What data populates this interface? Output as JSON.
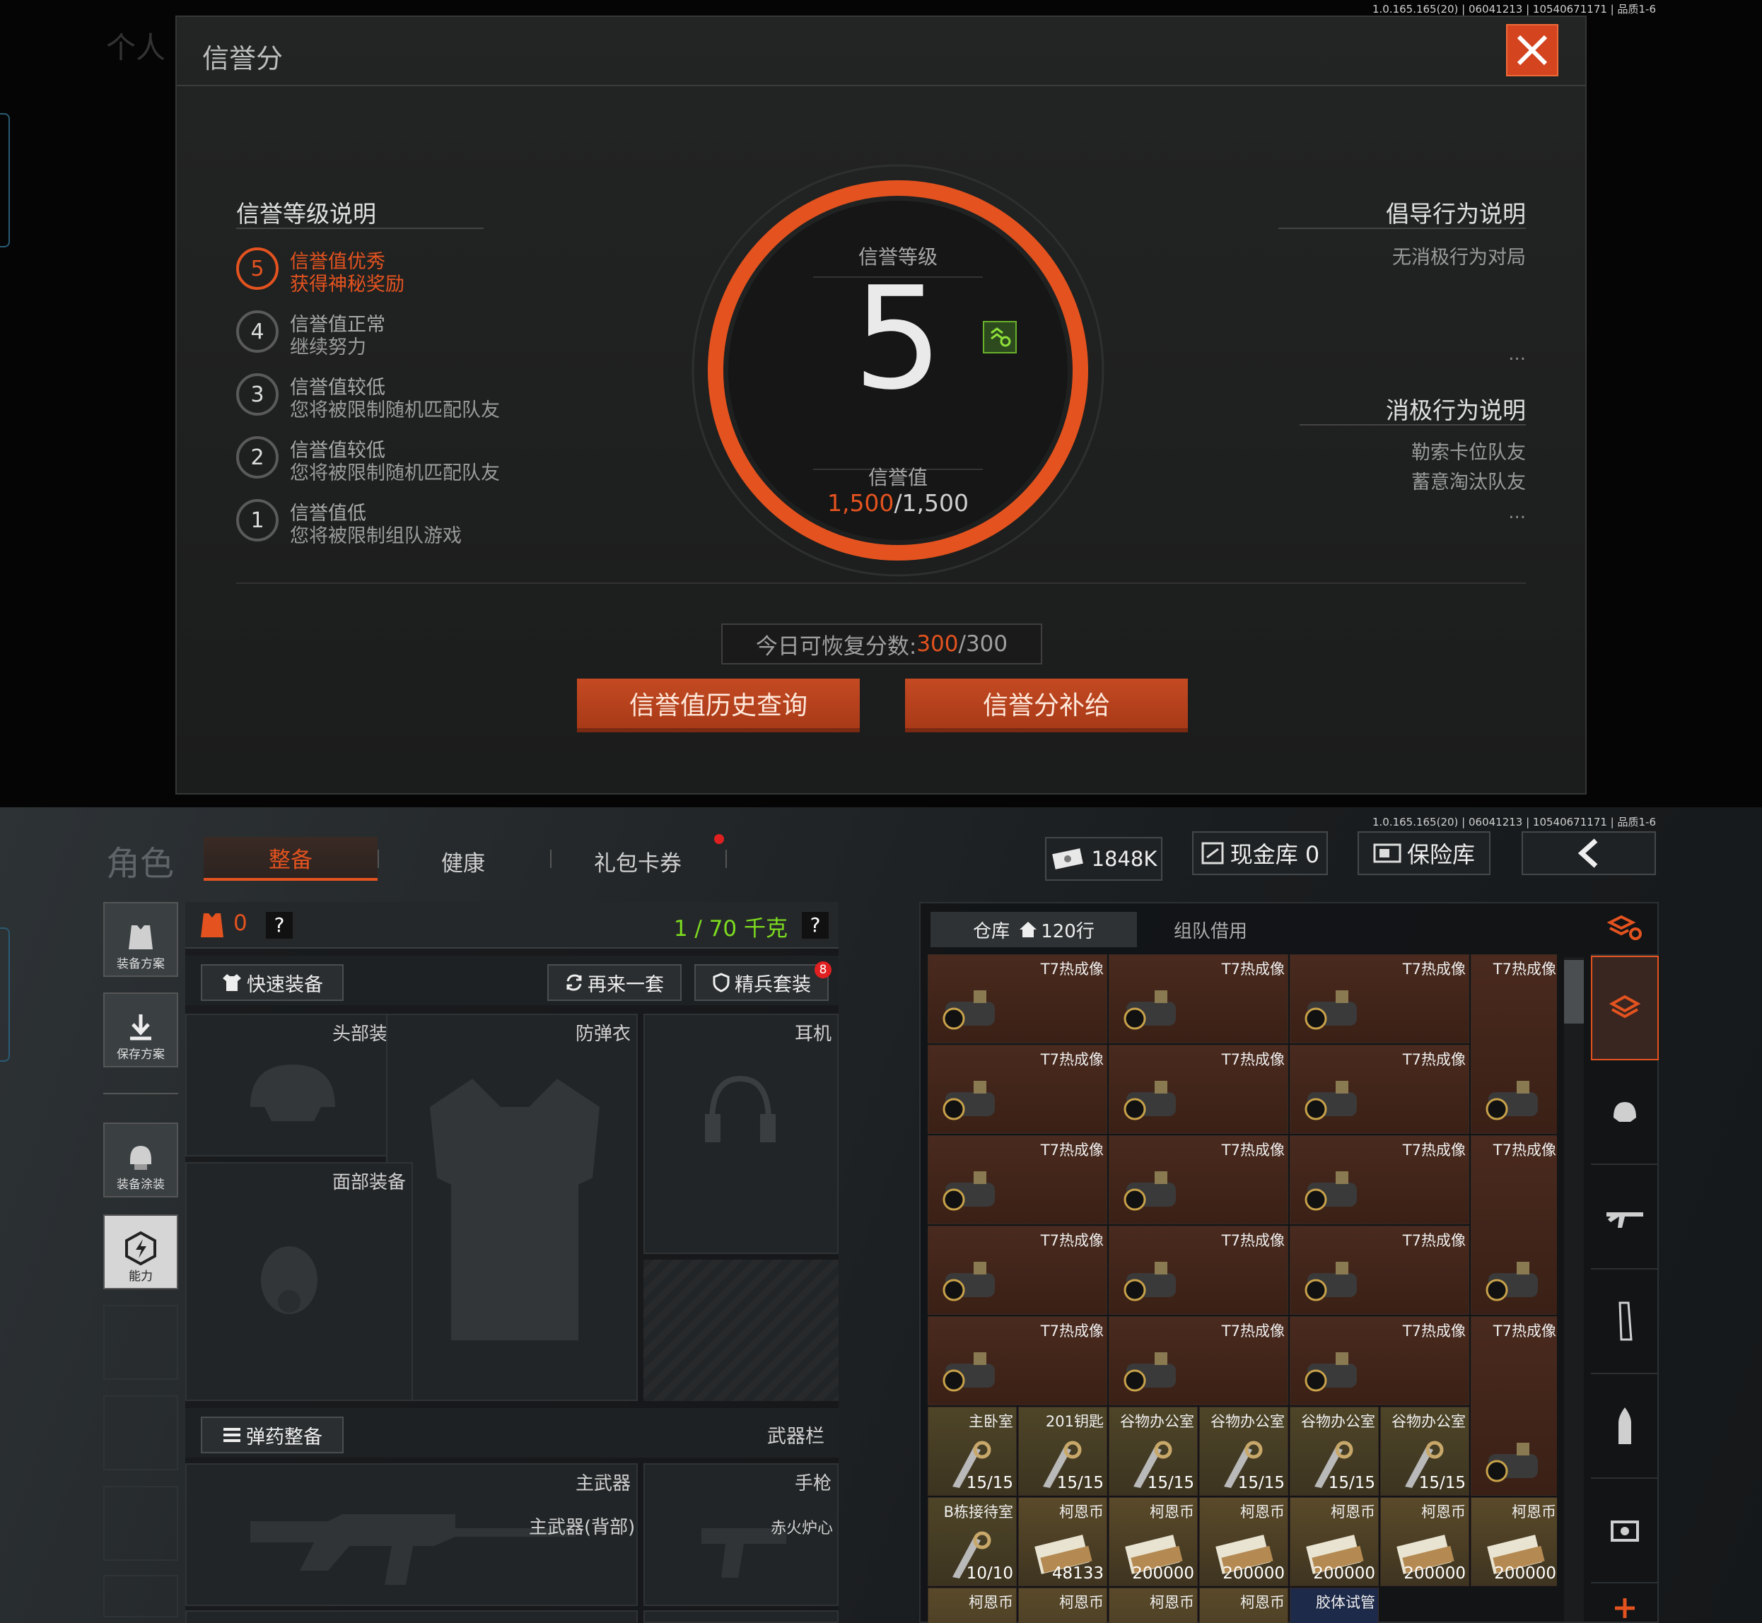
{
  "version_top": "1.0.165.165(20) | 06041213 | 10540671171 | 品质1-6",
  "version_bottom": "1.0.165.165(20) | 06041213 | 10540671171 | 品质1-6",
  "modal": {
    "title": "信誉分",
    "background_text": "个人",
    "left_section_title": "信誉等级说明",
    "levels": [
      {
        "num": "5",
        "line1": "信誉值优秀",
        "line2": "获得神秘奖励",
        "active": true
      },
      {
        "num": "4",
        "line1": "信誉值正常",
        "line2": "继续努力",
        "active": false
      },
      {
        "num": "3",
        "line1": "信誉值较低",
        "line2": "您将被限制随机匹配队友",
        "active": false
      },
      {
        "num": "2",
        "line1": "信誉值较低",
        "line2": "您将被限制随机匹配队友",
        "active": false
      },
      {
        "num": "1",
        "line1": "信誉值低",
        "line2": "您将被限制组队游戏",
        "active": false
      }
    ],
    "gauge": {
      "level_label": "信誉等级",
      "level_value": "5",
      "value_label": "信誉值",
      "current": "1,500",
      "max": "/1,500"
    },
    "positive_title": "倡导行为说明",
    "positive_items": [
      "无消极行为对局"
    ],
    "negative_title": "消极行为说明",
    "negative_items": [
      "勒索卡位队友",
      "蓄意淘汰队友"
    ],
    "ellipsis": "...",
    "recover_label": "今日可恢复分数:",
    "recover_current": "300",
    "recover_max": "/300",
    "btn_history": "信誉值历史查询",
    "btn_supply": "信誉分补给"
  },
  "colors": {
    "accent": "#e4531f",
    "green": "#7ddc1f",
    "active_level": "#e4531f"
  },
  "header": {
    "title": "角色",
    "tabs": [
      "整备",
      "健康",
      "礼包卡券"
    ],
    "money": "1848K",
    "cash_vault": "现金库 0",
    "safe": "保险库"
  },
  "left_bar": [
    "装备方案",
    "保存方案",
    "装备涂装",
    "能力"
  ],
  "gear": {
    "armor_count": "0",
    "weight": "1 / 70 千克",
    "quick_equip": "快速装备",
    "again": "再来一套",
    "elite": "精兵套装",
    "elite_badge": "8",
    "slots": {
      "head": "头部装备",
      "armor": "防弹衣",
      "headset": "耳机",
      "face": "面部装备"
    },
    "ammo_equip": "弹药整备",
    "weapon_bar": "武器栏",
    "weapons": {
      "primary": "主武器",
      "pistol": "手枪",
      "primary_back": "主武器(背部)",
      "melee": "赤火炉心"
    }
  },
  "warehouse": {
    "tab_storage": "仓库",
    "rows": "120行",
    "tab_team": "组队借用",
    "thermal_name": "T7热成像",
    "keys": [
      {
        "name": "主卧室",
        "count": "15/15"
      },
      {
        "name": "201钥匙",
        "count": "15/15"
      },
      {
        "name": "谷物办公室",
        "count": "15/15"
      },
      {
        "name": "谷物办公室",
        "count": "15/15"
      },
      {
        "name": "谷物办公室",
        "count": "15/15"
      },
      {
        "name": "谷物办公室",
        "count": "15/15"
      }
    ],
    "row7": [
      {
        "name": "B栋接待室",
        "count": "10/10"
      },
      {
        "name": "柯恩币",
        "count": "48133"
      },
      {
        "name": "柯恩币",
        "count": "200000"
      },
      {
        "name": "柯恩币",
        "count": "200000"
      },
      {
        "name": "柯恩币",
        "count": "200000"
      },
      {
        "name": "柯恩币",
        "count": "200000"
      },
      {
        "name": "柯恩币",
        "count": "200000"
      }
    ],
    "row8": [
      "柯恩币",
      "柯恩币",
      "柯恩币",
      "柯恩币",
      "胶体试管"
    ]
  }
}
